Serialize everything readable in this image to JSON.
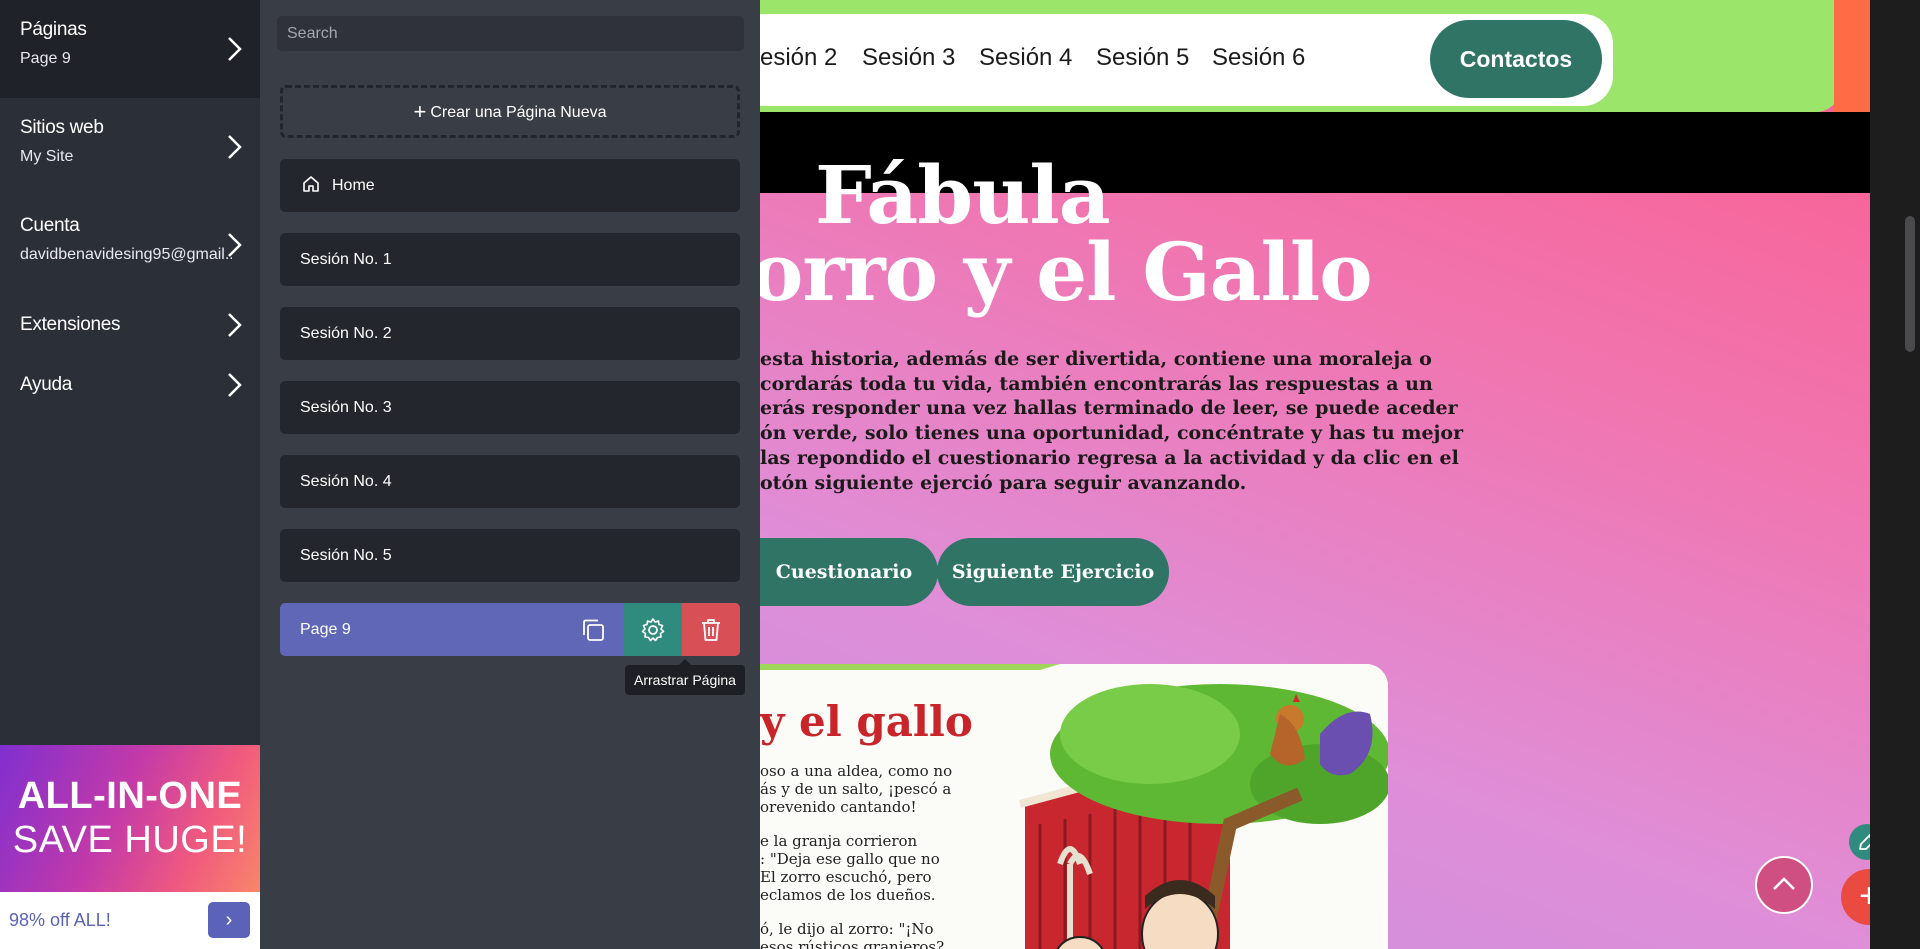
{
  "sidebar": {
    "items": [
      {
        "title": "Páginas",
        "subtitle": "Page 9"
      },
      {
        "title": "Sitios web",
        "subtitle": "My Site"
      },
      {
        "title": "Cuenta",
        "subtitle": "davidbenavidesing95@gmail..."
      },
      {
        "title": "Extensiones"
      },
      {
        "title": "Ayuda"
      }
    ],
    "promo": {
      "line1": "ALL-IN-ONE",
      "line2": "SAVE HUGE!",
      "bar_text": "98% off ALL!",
      "button_glyph": "›"
    }
  },
  "pages_panel": {
    "search_placeholder": "Search",
    "new_page_label": "Crear una Página Nueva",
    "pages": [
      {
        "label": "Home"
      },
      {
        "label": "Sesión No. 1"
      },
      {
        "label": "Sesión No. 2"
      },
      {
        "label": "Sesión No. 3"
      },
      {
        "label": "Sesión No. 4"
      },
      {
        "label": "Sesión No. 5"
      },
      {
        "label": "Page 9"
      }
    ],
    "tooltip": "Arrastrar Página"
  },
  "preview": {
    "nav": [
      "esión 2",
      "Sesión 3",
      "Sesión 4",
      "Sesión 5",
      "Sesión 6"
    ],
    "contact_button": "Contactos",
    "hero_line1": "Fábula",
    "hero_line2": "orro y el Gallo",
    "story_lines": [
      "esta historia, además de ser divertida, contiene una moraleja o",
      "cordarás toda tu vida, también encontrarás las respuestas a un",
      "erás responder una vez hallas terminado de leer, se puede aceder",
      "ón verde, solo tienes una oportunidad, concéntrate y has tu mejor",
      "las repondido el cuestionario regresa a la actividad y da clic en el",
      "otón siguiente ejerció para seguir avanzando."
    ],
    "buttons": {
      "quiz": "Cuestionario",
      "next": "Siguiente Ejercicio"
    },
    "image": {
      "title": "y el gallo",
      "lines": [
        "oso a una aldea, como no",
        "ás y de un salto, ¡pescó a",
        "orevenido cantando!",
        "e la granja corrieron",
        ": \"Deja ese gallo que no",
        "El zorro escuchó, pero",
        "eclamos de los dueños.",
        "ó, le dijo al zorro: \"¡No",
        "esos rústicos granjeros?"
      ]
    }
  },
  "colors": {
    "sidebar_bg": "#2b2f38",
    "panel_bg": "#393d46",
    "active_page": "#5f67b6",
    "teal": "#2f7465",
    "delete_red": "#d94f56",
    "header_green": "#9be56b"
  },
  "icons": [
    "chevron-right-icon",
    "plus-icon",
    "home-icon",
    "copy-icon",
    "gear-icon",
    "trash-icon",
    "arrow-up-icon",
    "pencil-icon"
  ]
}
